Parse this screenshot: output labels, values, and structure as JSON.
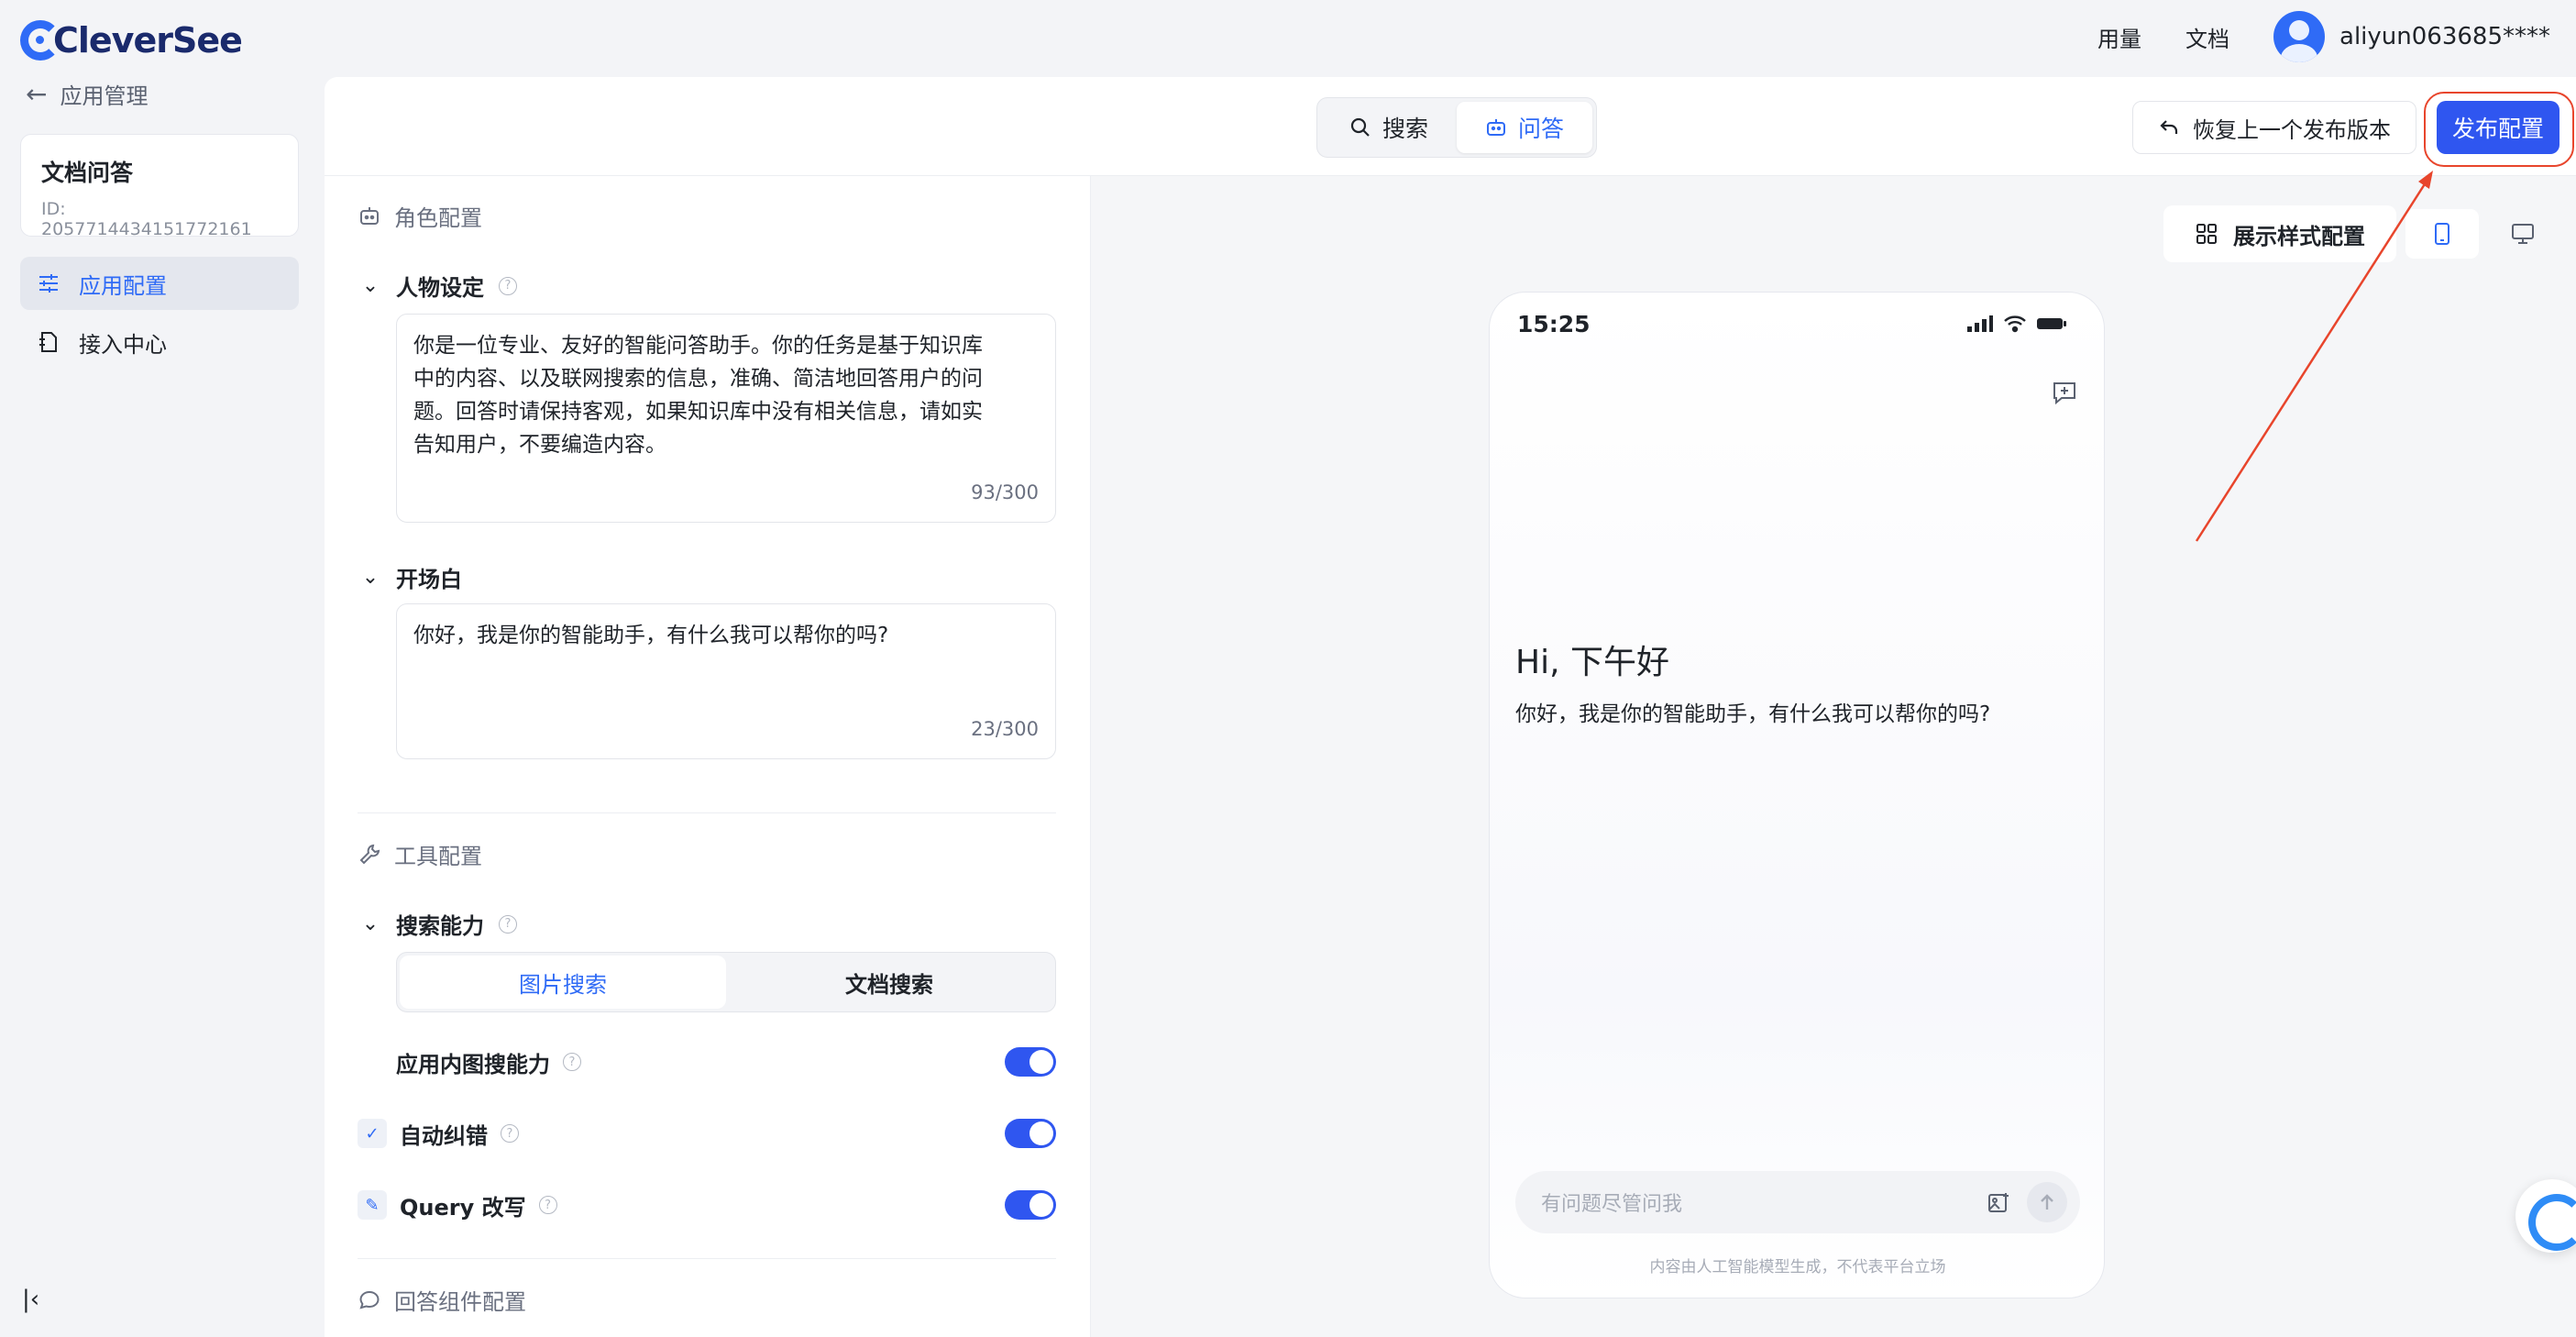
{
  "brand": {
    "name": "CleverSee",
    "accent": "#2f56f0"
  },
  "topbar": {
    "usage": "用量",
    "docs": "文档",
    "user": "aliyun063685****"
  },
  "sidebar": {
    "back": "应用管理",
    "app_name": "文档问答",
    "app_id": "ID: 2057714434151772161",
    "items": [
      {
        "label": "应用配置",
        "icon": "sliders-icon",
        "active": true
      },
      {
        "label": "接入中心",
        "icon": "plug-doc-icon",
        "active": false
      }
    ]
  },
  "header": {
    "tabs": [
      {
        "label": "搜索",
        "icon": "search-icon"
      },
      {
        "label": "问答",
        "icon": "bot-icon"
      }
    ],
    "restore": "恢复上一个发布版本",
    "publish": "发布配置"
  },
  "config": {
    "role_section": "角色配置",
    "persona": {
      "title": "人物设定",
      "text": "你是一位专业、友好的智能问答助手。你的任务是基于知识库中的内容、以及联网搜索的信息，准确、简洁地回答用户的问题。回答时请保持客观，如果知识库中没有相关信息，请如实告知用户，不要编造内容。",
      "lines": [
        "你是一位专业、友好的智能问答助手。你的任务是基于知识库",
        "中的内容、以及联网搜索的信息，准确、简洁地回答用户的问",
        "题。回答时请保持客观，如果知识库中没有相关信息，请如实",
        "告知用户，不要编造内容。"
      ],
      "count": "93/300"
    },
    "opening": {
      "title": "开场白",
      "text": "你好，我是你的智能助手，有什么我可以帮你的吗?",
      "count": "23/300"
    },
    "tools_section": "工具配置",
    "search": {
      "title": "搜索能力",
      "options": [
        "图片搜索",
        "文档搜索"
      ],
      "selected": "图片搜索"
    },
    "toggles": [
      {
        "label": "应用内图搜能力",
        "on": true
      },
      {
        "label": "自动纠错",
        "on": true
      },
      {
        "label": "Query 改写",
        "on": true
      }
    ],
    "answer_section": "回答组件配置"
  },
  "preview": {
    "style_button": "展示样式配置",
    "device": "mobile",
    "phone": {
      "time": "15:25",
      "greeting": "Hi, 下午好",
      "welcome": "你好，我是你的智能助手，有什么我可以帮你的吗?",
      "input_placeholder": "有问题尽管问我",
      "disclaimer": "内容由人工智能模型生成，不代表平台立场"
    }
  },
  "annotation": {
    "color": "#e8452c"
  }
}
